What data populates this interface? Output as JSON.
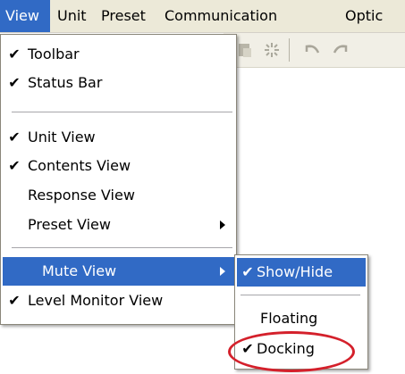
{
  "menubar": {
    "items": [
      "View",
      "Unit",
      "Preset",
      "Communication",
      "Optic"
    ]
  },
  "view_menu": {
    "items": [
      {
        "label": "Toolbar",
        "checked": true
      },
      {
        "label": "Status Bar",
        "checked": true
      },
      {
        "label": "Unit View",
        "checked": true
      },
      {
        "label": "Contents View",
        "checked": true
      },
      {
        "label": "Response View",
        "checked": false
      },
      {
        "label": "Preset View",
        "checked": false,
        "submenu": true
      },
      {
        "label": "Mute View",
        "checked": false,
        "submenu": true,
        "highlighted": true
      },
      {
        "label": "Level Monitor View",
        "checked": true
      }
    ]
  },
  "mute_submenu": {
    "items": [
      {
        "label": "Show/Hide",
        "checked": true,
        "highlighted": true
      },
      {
        "label": "Floating",
        "checked": false
      },
      {
        "label": "Docking",
        "checked": true,
        "circled": true
      }
    ]
  },
  "check_glyph": "✔",
  "colors": {
    "highlight": "#316ac5",
    "menubar_bg": "#ece9d8",
    "circle": "#d4202b"
  }
}
